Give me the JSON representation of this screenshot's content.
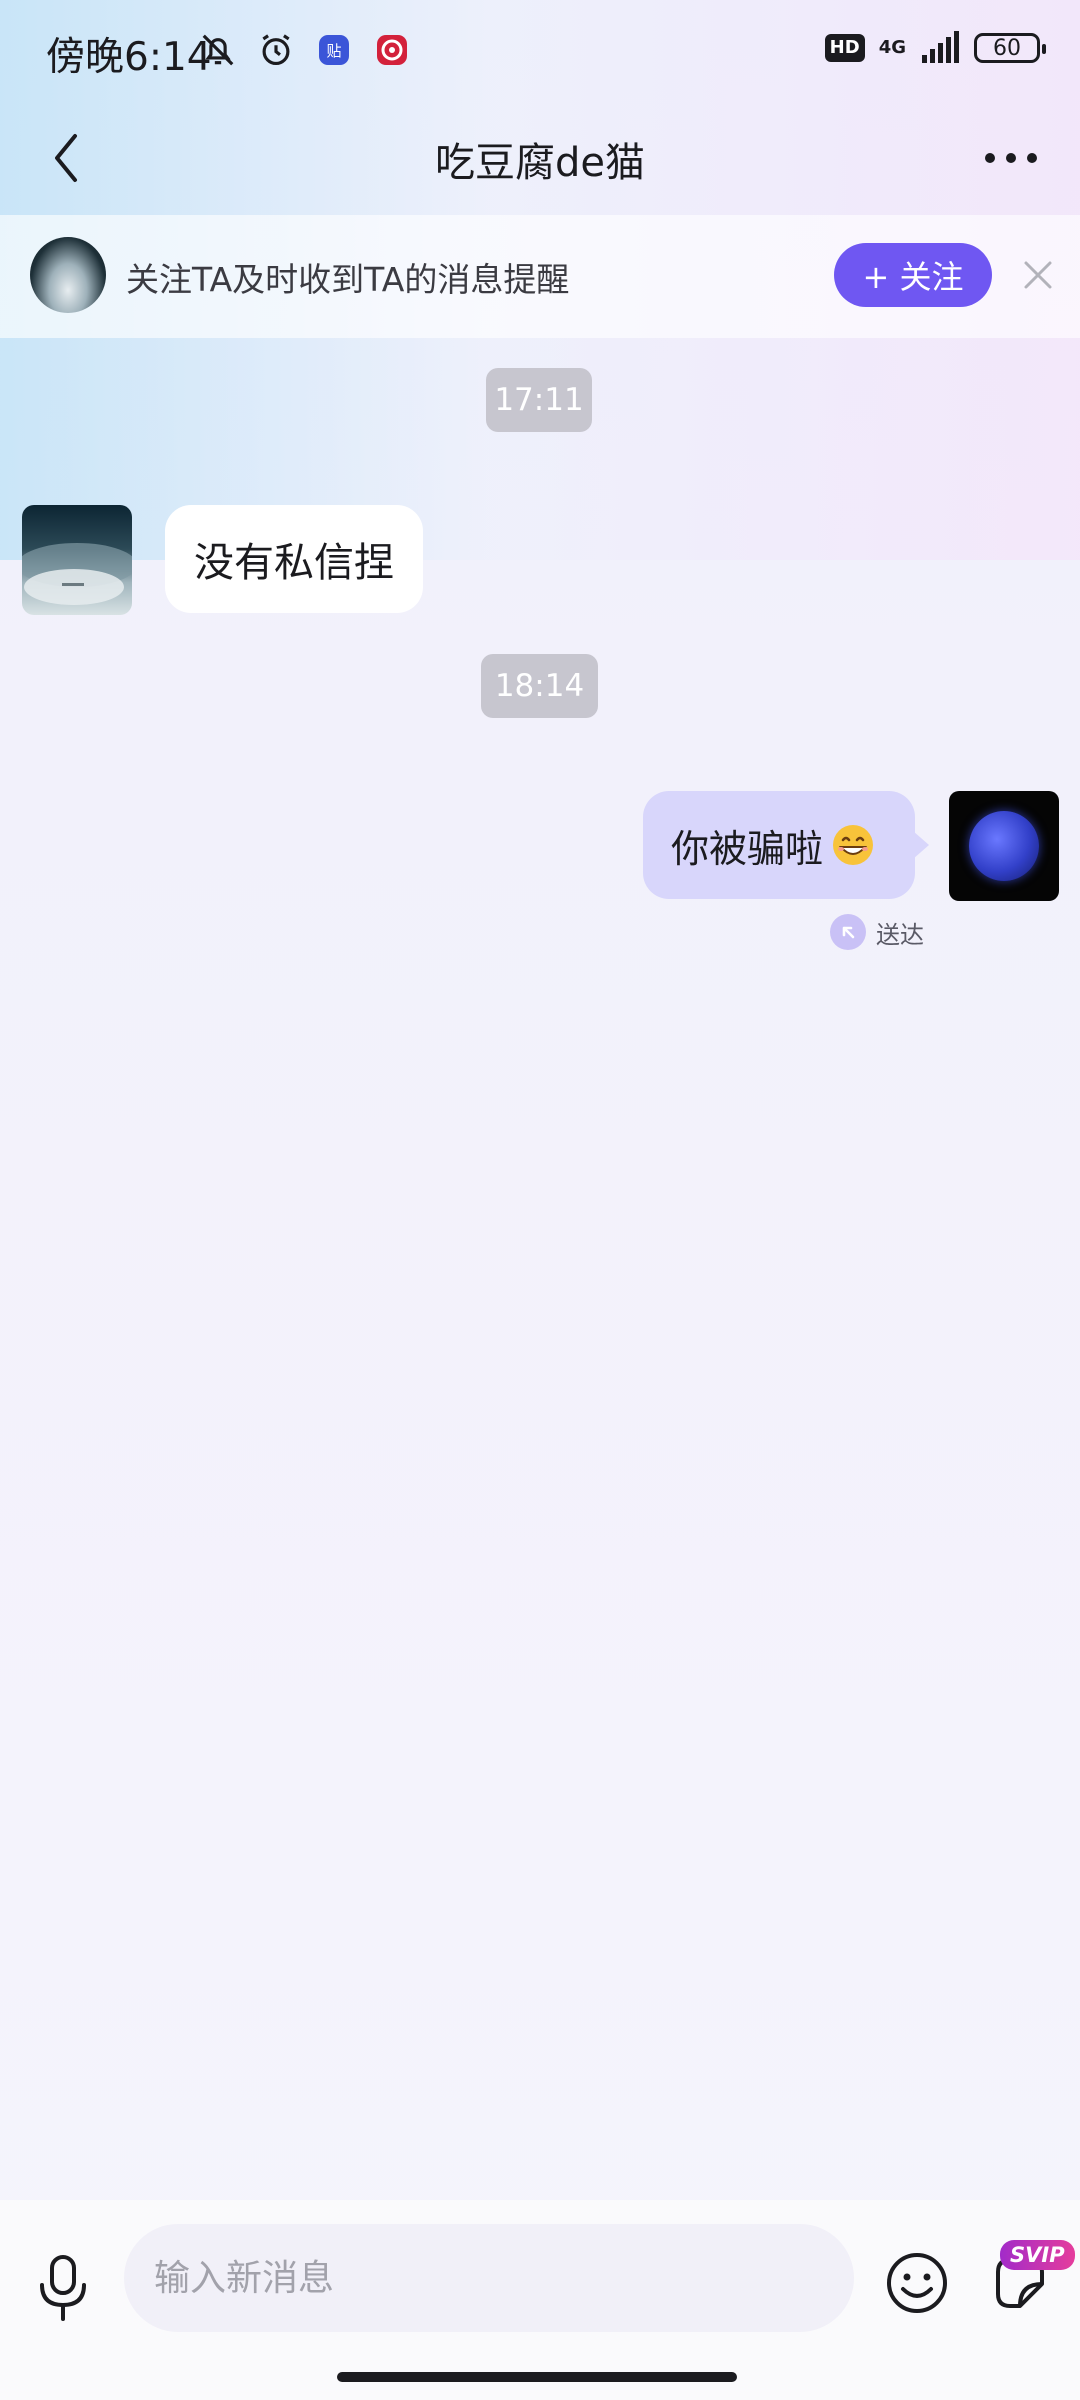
{
  "status_bar": {
    "time": "傍晚6:14",
    "icons": [
      "bell-muted-icon",
      "alarm-icon",
      "tieba-icon",
      "app-icon"
    ],
    "hd": "HD",
    "network": "4G",
    "battery": "60"
  },
  "header": {
    "title": "吃豆腐de猫",
    "back_icon": "chevron-left-icon",
    "more_icon": "more-dots-icon"
  },
  "follow_banner": {
    "text": "关注TA及时收到TA的消息提醒",
    "button_label": "+ 关注"
  },
  "messages": [
    {
      "type": "time",
      "text": "17:11"
    },
    {
      "type": "incoming",
      "text": "没有私信捏"
    },
    {
      "type": "time",
      "text": "18:14"
    },
    {
      "type": "outgoing",
      "text": "你被骗啦",
      "status": "送达"
    }
  ],
  "input": {
    "placeholder": "输入新消息",
    "value": ""
  },
  "svip": "SVIP",
  "colors": {
    "accent": "#6f57f2",
    "outgoing_bubble": "#d8d6fb",
    "svip": "#c533b0"
  }
}
